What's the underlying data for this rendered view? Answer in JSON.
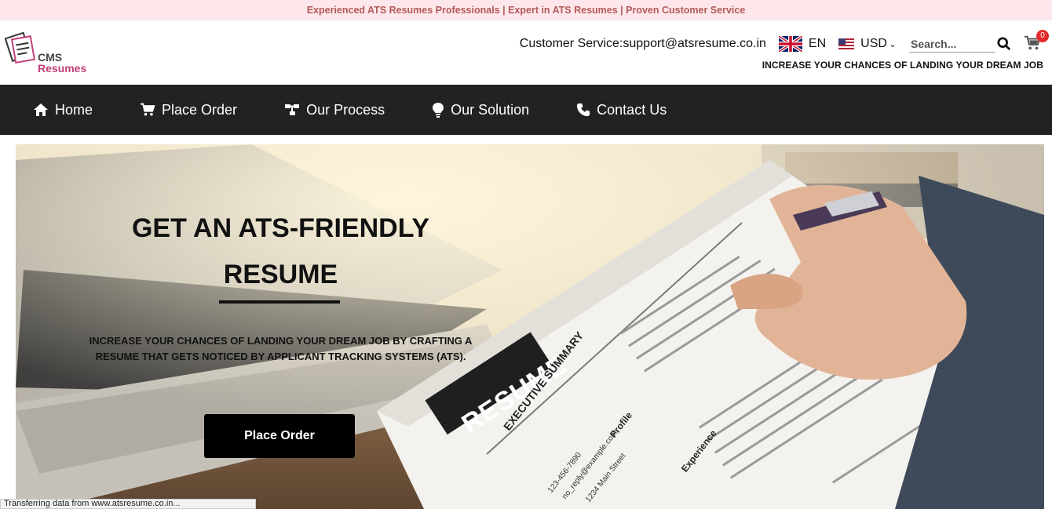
{
  "announcement": "Experienced ATS Resumes Professionals | Expert in ATS Resumes | Proven Customer Service",
  "logo": {
    "line1": "CMS",
    "line2": "Resumes"
  },
  "header": {
    "customer_service": "Customer Service:support@atsresume.co.in",
    "language": "EN",
    "currency": "USD",
    "search_placeholder": "Search...",
    "cart_count": "0",
    "tagline": "INCREASE YOUR CHANCES OF LANDING YOUR DREAM JOB"
  },
  "nav": {
    "items": [
      {
        "label": "Home",
        "icon": "home-icon"
      },
      {
        "label": "Place Order",
        "icon": "cart-icon"
      },
      {
        "label": "Our Process",
        "icon": "sitemap-icon"
      },
      {
        "label": "Our Solution",
        "icon": "lightbulb-icon"
      },
      {
        "label": "Contact Us",
        "icon": "phone-icon"
      }
    ]
  },
  "hero": {
    "title_line1": "GET AN ATS-FRIENDLY",
    "title_line2": "RESUME",
    "subtitle": "INCREASE YOUR CHANCES OF LANDING YOUR DREAM JOB BY CRAFTING A RESUME THAT GETS NOTICED BY APPLICANT TRACKING SYSTEMS (ATS).",
    "cta_label": "Place Order",
    "paper_heading": "RESUME",
    "paper_section1": "EXECUTIVE SUMMARY",
    "paper_section2": "Profile",
    "paper_section3": "Experience",
    "paper_phone": "123-456-7890",
    "paper_email": "no_reply@example.com",
    "paper_address": "1234 Main Street"
  },
  "status_bar": "Transferring data from www.atsresume.co.in...",
  "colors": {
    "topbar_bg": "#fde7ea",
    "topbar_text": "#b35a5a",
    "nav_bg": "#222222",
    "accent": "#c2407a",
    "badge": "#e52b2b"
  }
}
